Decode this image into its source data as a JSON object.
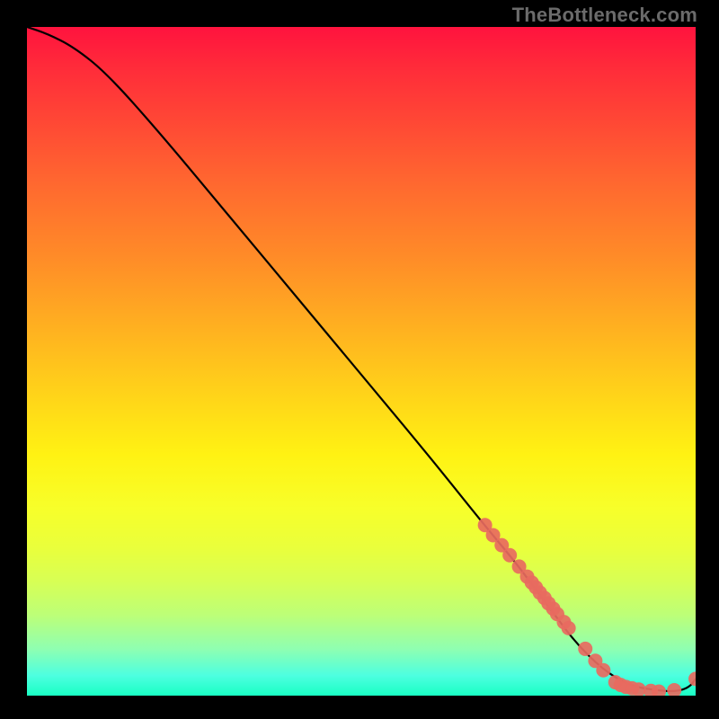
{
  "watermark": "TheBottleneck.com",
  "chart_data": {
    "type": "line",
    "title": "",
    "xlabel": "",
    "ylabel": "",
    "xlim": [
      0,
      100
    ],
    "ylim": [
      0,
      100
    ],
    "grid": false,
    "legend": false,
    "series": [
      {
        "name": "curve",
        "style": "line",
        "color": "#000000",
        "x": [
          0,
          3,
          7,
          12,
          20,
          30,
          40,
          50,
          60,
          68,
          73,
          76,
          79,
          82,
          86,
          90,
          94,
          97,
          99,
          100
        ],
        "y": [
          100,
          99,
          97,
          93,
          84,
          72,
          60,
          48,
          36,
          26,
          20,
          16,
          12,
          8,
          4,
          1.5,
          0.8,
          0.6,
          1.2,
          2.5
        ]
      },
      {
        "name": "highlight-points",
        "style": "scatter",
        "color": "#e86a60",
        "radius": 8,
        "x": [
          68.5,
          69.7,
          71.0,
          72.2,
          73.6,
          74.8,
          75.5,
          76.1,
          76.7,
          77.4,
          78.0,
          78.7,
          79.3,
          80.3,
          81.0,
          83.5,
          85.0,
          86.2,
          88.0,
          88.8,
          89.6,
          90.5,
          91.5,
          93.3,
          94.5,
          96.8,
          100.0
        ],
        "y": [
          25.5,
          24.0,
          22.5,
          21.0,
          19.3,
          17.8,
          16.9,
          16.2,
          15.4,
          14.6,
          13.8,
          13.0,
          12.2,
          11.0,
          10.1,
          7.0,
          5.2,
          3.8,
          2.0,
          1.6,
          1.3,
          1.1,
          0.9,
          0.7,
          0.6,
          0.8,
          2.5
        ]
      }
    ]
  }
}
